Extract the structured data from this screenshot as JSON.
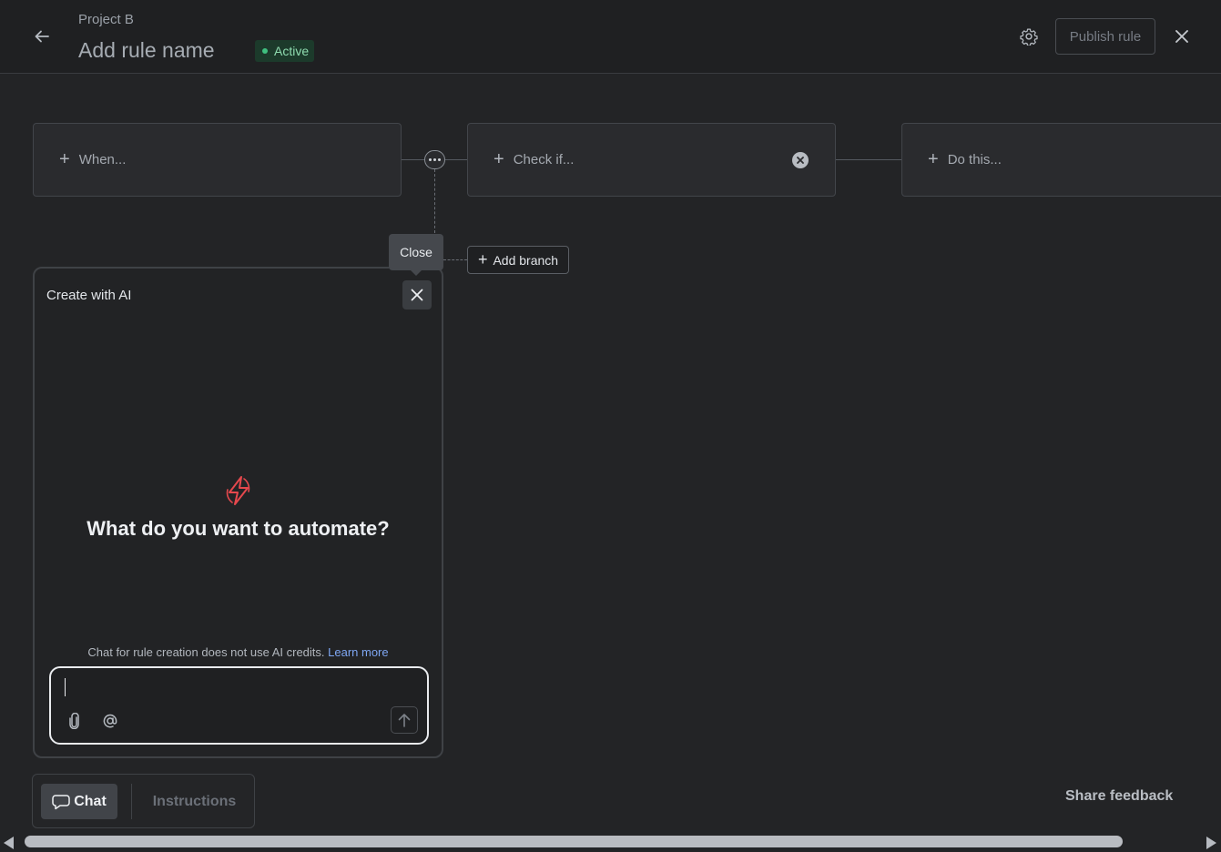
{
  "header": {
    "project": "Project B",
    "rule_name": "Add rule name",
    "status": "Active",
    "publish_label": "Publish rule"
  },
  "canvas": {
    "trigger_label": "When...",
    "condition_label": "Check if...",
    "action_label": "Do this...",
    "add_branch_label": "Add branch"
  },
  "tooltip": {
    "text": "Close"
  },
  "ai_panel": {
    "title": "Create with AI",
    "heading": "What do you want to automate?",
    "note": "Chat for rule creation does not use AI credits.",
    "learn_more": "Learn more",
    "input_value": "",
    "input_placeholder": ""
  },
  "mode_tabs": {
    "chat_label": "Chat",
    "instructions_label": "Instructions",
    "active": "Chat"
  },
  "footer": {
    "share_feedback": "Share feedback"
  },
  "colors": {
    "status_active": "#3fbf7f",
    "link": "#7ea6f2",
    "ai_bolt": "#e5484d"
  },
  "scroll": {
    "horizontal_visible_fraction": 0.92
  }
}
